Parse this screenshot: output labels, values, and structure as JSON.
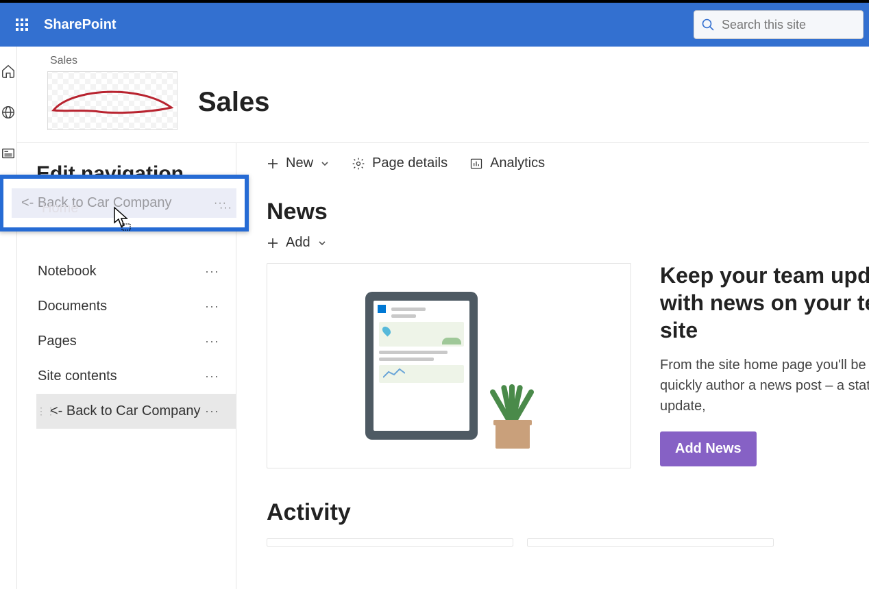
{
  "app": {
    "name": "SharePoint"
  },
  "search": {
    "placeholder": "Search this site"
  },
  "site": {
    "breadcrumb": "Sales",
    "title": "Sales"
  },
  "editNav": {
    "title": "Edit navigation",
    "dragItem": {
      "label": "<- Back to Car Company",
      "faint": "Home"
    },
    "items": [
      {
        "label": "Notebook"
      },
      {
        "label": "Documents"
      },
      {
        "label": "Pages"
      },
      {
        "label": "Site contents"
      },
      {
        "label": "<- Back to Car Company",
        "selected": true
      }
    ]
  },
  "cmdbar": {
    "new": "New",
    "pageDetails": "Page details",
    "analytics": "Analytics"
  },
  "news": {
    "title": "News",
    "add": "Add",
    "headline": "Keep your team updated with news on your team site",
    "body": "From the site home page you'll be able to quickly author a news post – a status update,",
    "button": "Add News"
  },
  "activity": {
    "title": "Activity"
  }
}
